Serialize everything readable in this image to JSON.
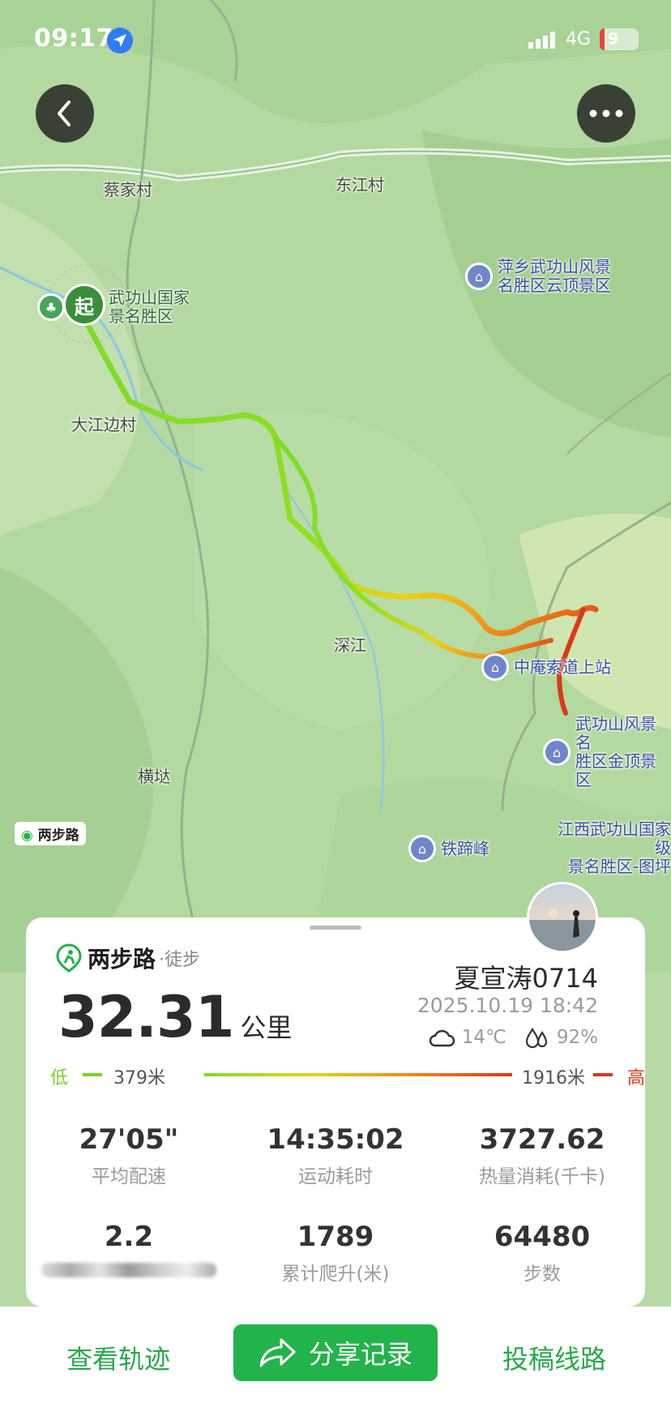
{
  "status_bar": {
    "time": "09:17",
    "network": "4G",
    "battery": "9"
  },
  "map": {
    "labels": {
      "caijia": "蔡家村",
      "dongjiang": "东江村",
      "dajiangbian": "大江边村",
      "shenjiang": "深江",
      "henglin": "横垯",
      "brand_tag": "两步路"
    },
    "start_marker": "起",
    "pois": {
      "yunding_1": "萍乡武功山风景",
      "yunding_2": "名胜区云顶景区",
      "park_1": "武功山国家",
      "park_2": "景名胜区",
      "zhongan": "中庵索道上站",
      "jinding_1": "武功山风景名",
      "jinding_2": "胜区金顶景区",
      "tiiti": "铁蹄峰",
      "jiangxi_1": "江西武功山国家级",
      "jiangxi_2": "景名胜区-图坪"
    }
  },
  "card": {
    "brand": "两步路",
    "activity": "·徒步",
    "distance": "32.31",
    "distance_unit": "公里",
    "user": "夏宣涛0714",
    "date": "2025.10.19 18:42",
    "temperature": "14℃",
    "humidity": "92%",
    "elevation": {
      "low_label": "低",
      "low": "379米",
      "high": "1916米",
      "high_label": "高"
    },
    "stats": [
      {
        "value": "27'05\"",
        "label": "平均配速"
      },
      {
        "value": "14:35:02",
        "label": "运动耗时"
      },
      {
        "value": "3727.62",
        "label": "热量消耗(千卡)"
      },
      {
        "value": "2.2",
        "label": ""
      },
      {
        "value": "1789",
        "label": "累计爬升(米)"
      },
      {
        "value": "64480",
        "label": "步数"
      }
    ]
  },
  "actions": {
    "view_track": "查看轨迹",
    "share": "分享记录",
    "submit_route": "投稿线路"
  },
  "colors": {
    "accent": "#22b34a",
    "track_low": "#7ddb2a",
    "track_high": "#d93a1a"
  }
}
